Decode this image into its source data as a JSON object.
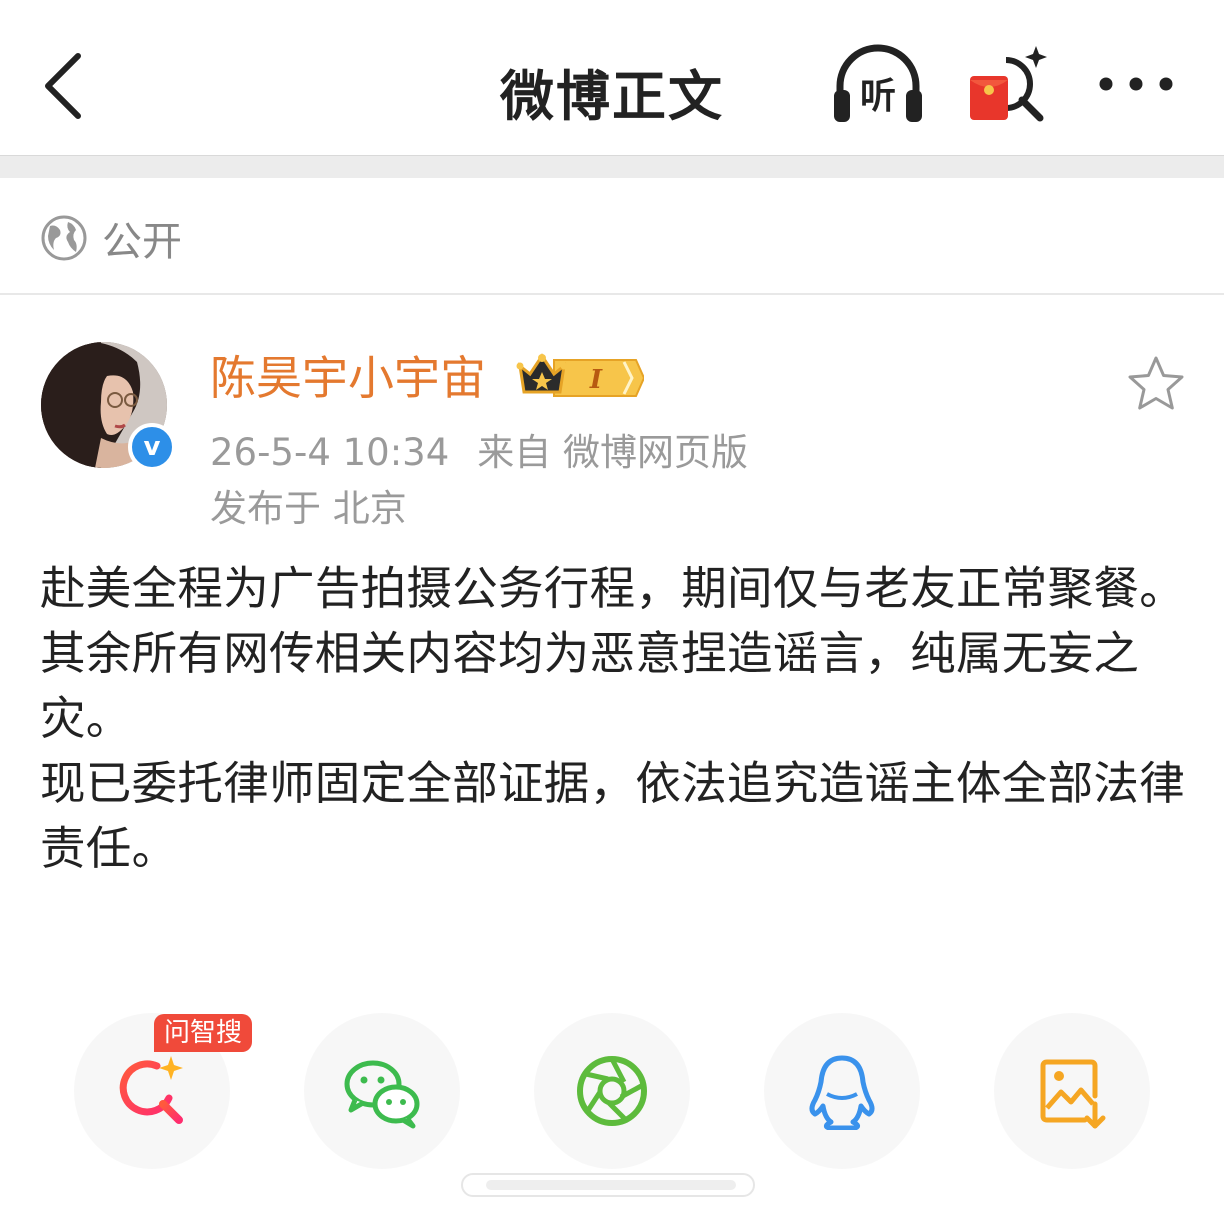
{
  "header": {
    "title": "微博正文",
    "listen_label": "听"
  },
  "visibility": {
    "label": "公开"
  },
  "post": {
    "author": "陈昊宇小宇宙",
    "vip_level": "I",
    "time": "26-5-4 10:34",
    "source": "来自 微博网页版",
    "location": "发布于 北京",
    "paragraphs": [
      "赴美全程为广告拍摄公务行程，期间仅与老友正常聚餐。",
      "其余所有网传相关内容均为恶意捏造谣言，纯属无妄之灾。",
      "现已委托律师固定全部证据，依法追究造谣主体全部法律责任。"
    ]
  },
  "share": {
    "zhisou_badge": "问智搜",
    "items": [
      "zhisou-search-icon",
      "wechat-icon",
      "moments-icon",
      "qq-icon",
      "save-image-icon"
    ]
  },
  "colors": {
    "username": "#e4792f",
    "verified": "#2d8fe8",
    "badge_red": "#f04a3a",
    "wechat_green": "#3dbb4e",
    "qq_blue": "#3a92ec",
    "save_orange": "#f5a623"
  }
}
